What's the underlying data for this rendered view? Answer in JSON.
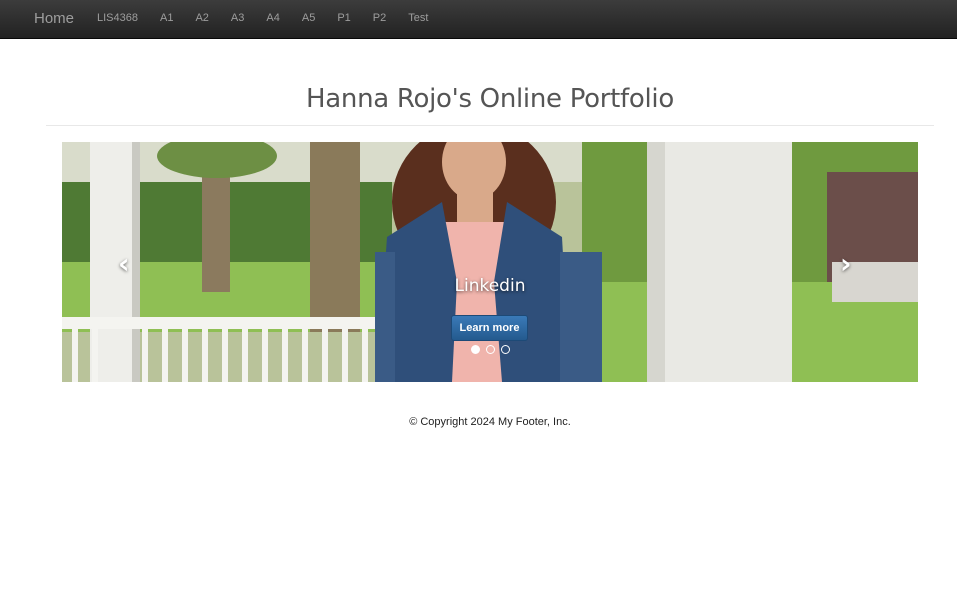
{
  "navbar": {
    "brand": "Home",
    "links": [
      "LIS4368",
      "A1",
      "A2",
      "A3",
      "A4",
      "A5",
      "P1",
      "P2",
      "Test"
    ]
  },
  "page": {
    "title": "Hanna Rojo's Online Portfolio"
  },
  "carousel": {
    "caption": "Linkedin",
    "button_label": "Learn more",
    "prev_icon": "chevron-left-icon",
    "next_icon": "chevron-right-icon",
    "prev_glyph": "‹",
    "next_glyph": "›",
    "slide_count": 3,
    "active_index": 0
  },
  "footer": {
    "copyright": "© Copyright 2024 My Footer, Inc."
  }
}
